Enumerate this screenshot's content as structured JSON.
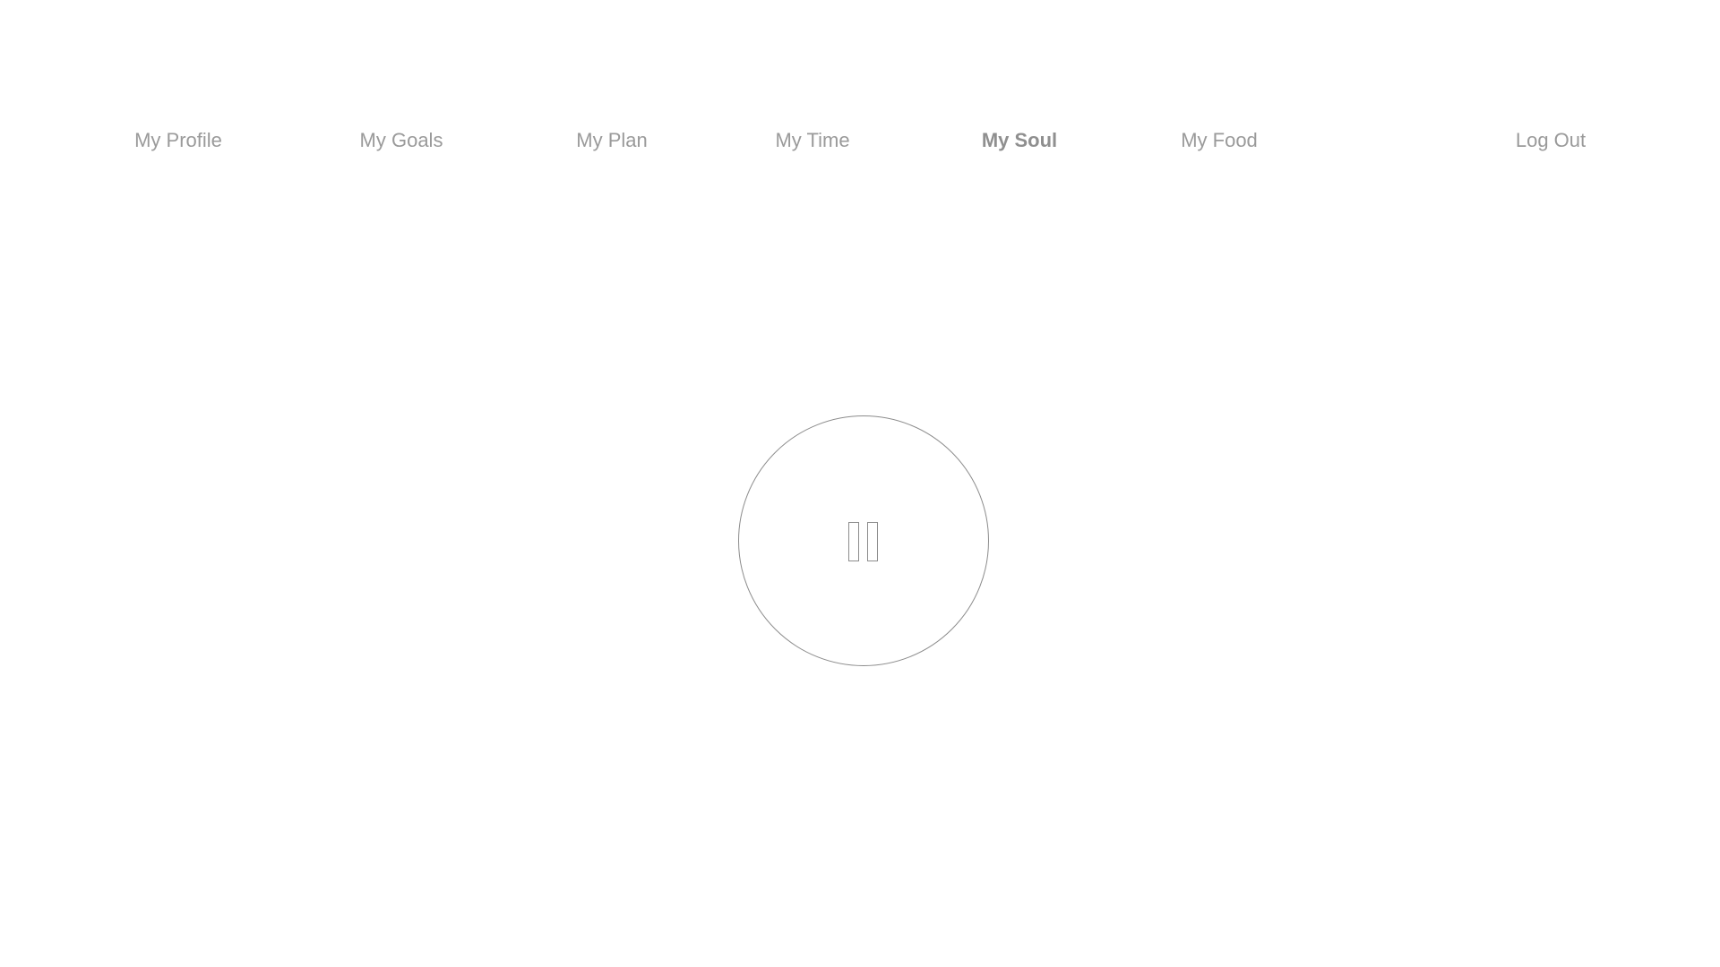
{
  "nav": {
    "items": [
      {
        "label": "My Profile",
        "active": false
      },
      {
        "label": "My Goals",
        "active": false
      },
      {
        "label": "My Plan",
        "active": false
      },
      {
        "label": "My Time",
        "active": false
      },
      {
        "label": "My Soul",
        "active": true
      },
      {
        "label": "My Food",
        "active": false
      }
    ],
    "logout_label": "Log Out"
  },
  "player": {
    "icon": "pause-icon",
    "state": "playing"
  },
  "colors": {
    "background": "#ffffff",
    "nav_text": "#9a9a9a",
    "outline": "#8c8c8c"
  }
}
